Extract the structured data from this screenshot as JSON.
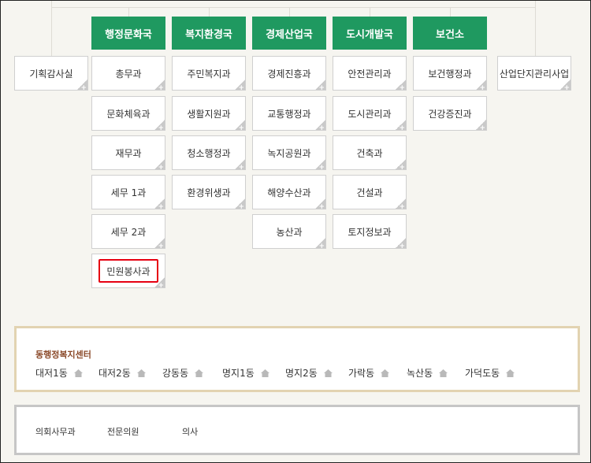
{
  "departments": [
    {
      "label": "행정문화국"
    },
    {
      "label": "복지환경국"
    },
    {
      "label": "경제산업국"
    },
    {
      "label": "도시개발국"
    },
    {
      "label": "보건소"
    }
  ],
  "standalone": {
    "left": "기획감사실",
    "right": "산업단지관리사업"
  },
  "columns": [
    [
      "총무과",
      "문화체육과",
      "재무과",
      "세무 1과",
      "세무 2과",
      "민원봉사과"
    ],
    [
      "주민복지과",
      "생활지원과",
      "청소행정과",
      "환경위생과"
    ],
    [
      "경제진흥과",
      "교통행정과",
      "녹지공원과",
      "해양수산과",
      "농산과"
    ],
    [
      "안전관리과",
      "도시관리과",
      "건축과",
      "건설과",
      "토지정보과"
    ],
    [
      "보건행정과",
      "건강증진과"
    ]
  ],
  "highlighted": "민원봉사과",
  "welfare_center": {
    "title": "동행정복지센터",
    "dongs": [
      "대저1동",
      "대저2동",
      "강동동",
      "명지1동",
      "명지2동",
      "가락동",
      "녹산동",
      "가덕도동"
    ]
  },
  "council": {
    "items": [
      "의회사무과",
      "전문의원",
      "의사"
    ]
  },
  "colors": {
    "dept_green": "#1f9960",
    "highlight_red": "#e60012",
    "panel_gold": "#e2d3b1",
    "panel_gray": "#c6c6c6"
  }
}
